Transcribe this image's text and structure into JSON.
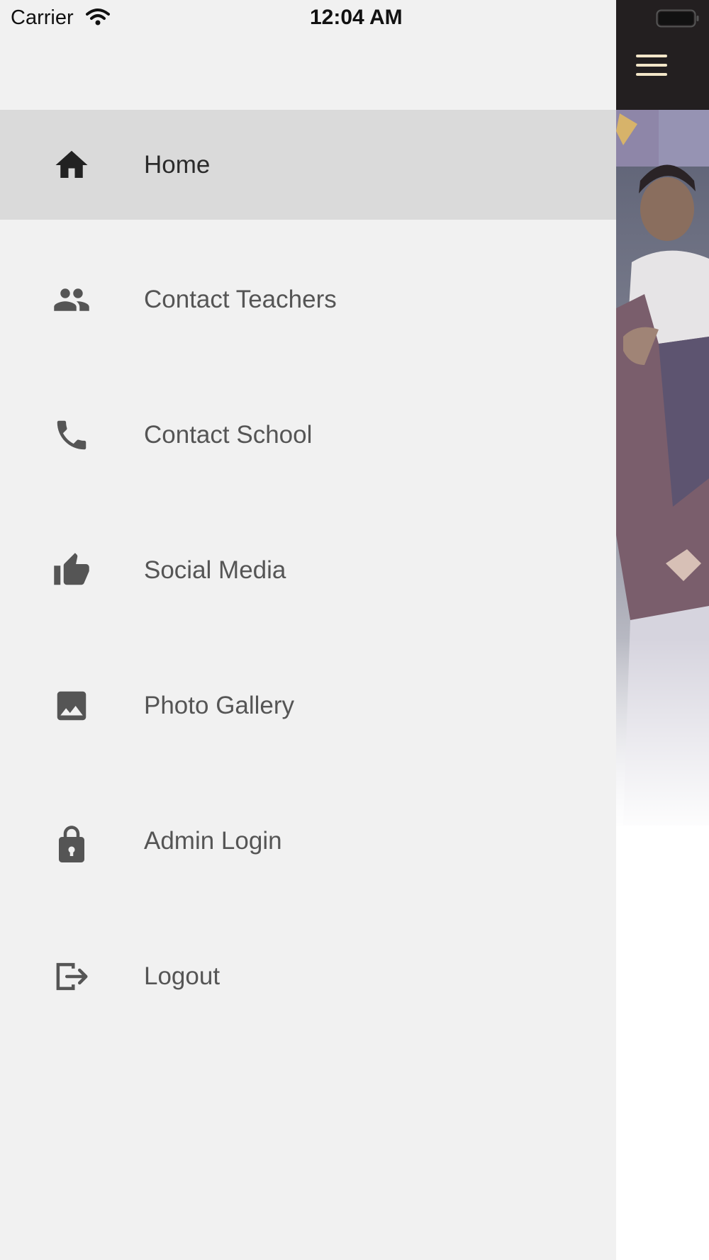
{
  "status_bar": {
    "carrier": "Carrier",
    "time": "12:04 AM",
    "wifi_icon": "wifi-icon",
    "battery_icon": "battery-icon"
  },
  "header": {
    "menu_icon": "hamburger-menu-icon",
    "header_color": "#231f20",
    "menu_icon_color": "#f3e6c8"
  },
  "drawer": {
    "background": "#f1f1f1",
    "active_background": "#dadada",
    "items": [
      {
        "label": "Home",
        "icon": "home-icon",
        "active": true
      },
      {
        "label": "Contact Teachers",
        "icon": "people-icon",
        "active": false
      },
      {
        "label": "Contact School",
        "icon": "phone-icon",
        "active": false
      },
      {
        "label": "Social Media",
        "icon": "thumbs-up-icon",
        "active": false
      },
      {
        "label": "Photo Gallery",
        "icon": "image-icon",
        "active": false
      },
      {
        "label": "Admin Login",
        "icon": "lock-icon",
        "active": false
      },
      {
        "label": "Logout",
        "icon": "logout-icon",
        "active": false
      }
    ]
  }
}
